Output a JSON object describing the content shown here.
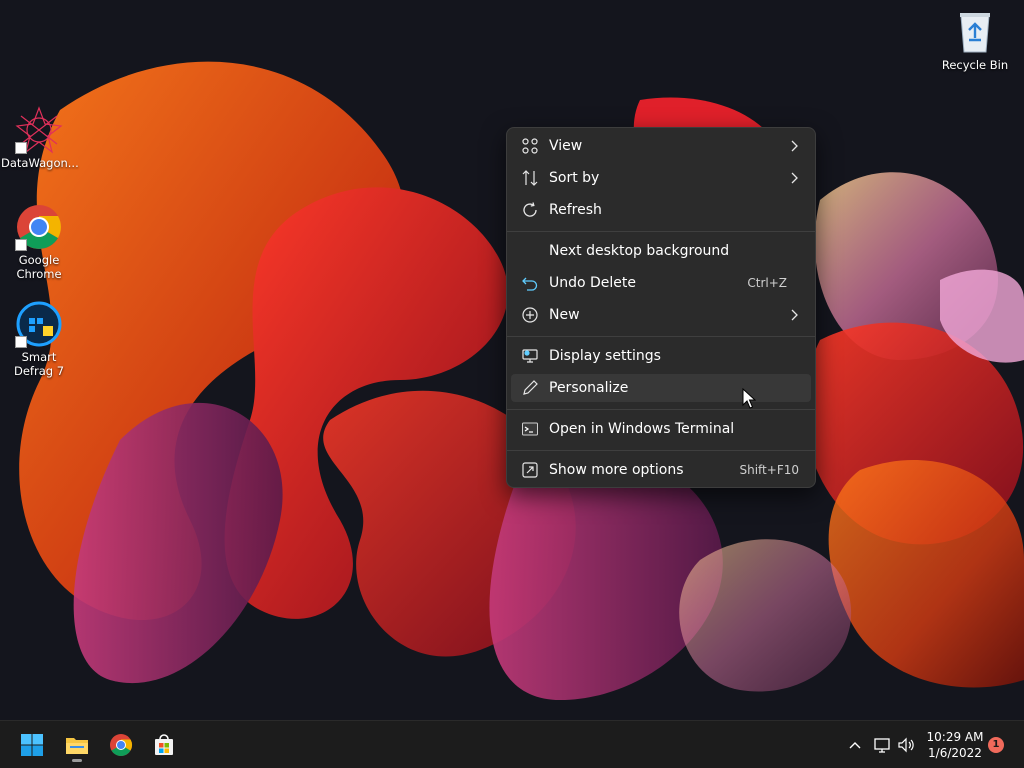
{
  "desktop": {
    "icons": [
      {
        "label": "DataWagon...",
        "icon": "datawagon-icon"
      },
      {
        "label": "Google Chrome",
        "icon": "chrome-icon"
      },
      {
        "label": "Smart Defrag 7",
        "icon": "smart-defrag-icon"
      },
      {
        "label": "Recycle Bin",
        "icon": "recycle-bin-icon"
      }
    ]
  },
  "context_menu": {
    "items": [
      {
        "label": "View",
        "icon": "grid-icon",
        "submenu": true
      },
      {
        "label": "Sort by",
        "icon": "sort-icon",
        "submenu": true
      },
      {
        "label": "Refresh",
        "icon": "refresh-icon"
      },
      {
        "label": "Next desktop background",
        "icon": ""
      },
      {
        "label": "Undo Delete",
        "icon": "undo-icon",
        "shortcut": "Ctrl+Z"
      },
      {
        "label": "New",
        "icon": "plus-circle-icon",
        "submenu": true
      },
      {
        "label": "Display settings",
        "icon": "display-icon"
      },
      {
        "label": "Personalize",
        "icon": "pencil-icon",
        "hovered": true
      },
      {
        "label": "Open in Windows Terminal",
        "icon": "terminal-icon"
      },
      {
        "label": "Show more options",
        "icon": "share-icon",
        "shortcut": "Shift+F10"
      }
    ]
  },
  "taskbar": {
    "buttons": [
      "start-icon",
      "file-explorer-icon",
      "chrome-icon",
      "store-icon"
    ],
    "tray": [
      "chevron-up-icon",
      "network-icon",
      "volume-icon"
    ],
    "time": "10:29 AM",
    "date": "1/6/2022",
    "notification_count": "1"
  },
  "colors": {
    "accent": "#60cdff",
    "menu_bg": "#2b2b2b",
    "taskbar_bg": "#1c1c1c",
    "badge": "#f06a5b"
  }
}
